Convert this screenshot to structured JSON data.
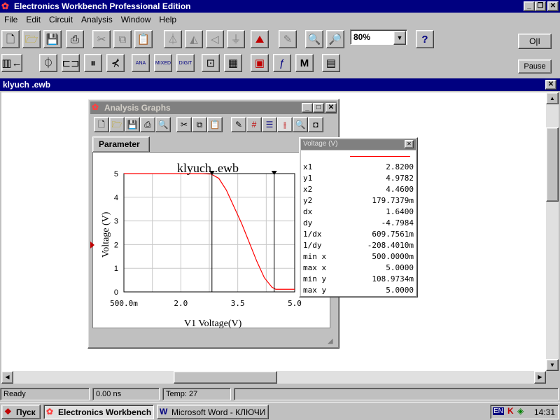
{
  "app": {
    "title": "Electronics Workbench Professional Edition",
    "menu": [
      "File",
      "Edit",
      "Circuit",
      "Analysis",
      "Window",
      "Help"
    ],
    "zoom": "80%",
    "pause_label": "Pause",
    "switch_label": "O|I"
  },
  "circuit_window": {
    "title": "klyuch .ewb"
  },
  "analysis": {
    "title": "Analysis Graphs",
    "tab": "Parameter"
  },
  "chart_data": {
    "type": "line",
    "title": "klyuch .ewb",
    "xlabel": "V1 Voltage(V)",
    "ylabel": "Voltage (V)",
    "xlim": [
      0.5,
      5.0
    ],
    "ylim": [
      0,
      5
    ],
    "x_ticks": [
      "500.0m",
      "2.0",
      "3.5",
      "5.0"
    ],
    "x_tick_values": [
      0.5,
      2.0,
      3.5,
      5.0
    ],
    "y_ticks": [
      "0",
      "1",
      "2",
      "3",
      "4",
      "5"
    ],
    "grid": true,
    "cursors": [
      2.82,
      4.46
    ],
    "series": [
      {
        "color": "#ff0000",
        "x": [
          0.5,
          2.5,
          2.8,
          3.0,
          3.2,
          3.4,
          3.6,
          3.8,
          4.0,
          4.2,
          4.4,
          4.5,
          5.0
        ],
        "y": [
          5.0,
          5.0,
          4.98,
          4.8,
          4.3,
          3.6,
          2.9,
          2.1,
          1.3,
          0.6,
          0.2,
          0.11,
          0.11
        ]
      }
    ]
  },
  "cursor_panel": {
    "title": "Voltage (V)",
    "rows": [
      {
        "label": "x1",
        "value": "2.8200"
      },
      {
        "label": "y1",
        "value": "4.9782"
      },
      {
        "label": "x2",
        "value": "4.4600"
      },
      {
        "label": "y2",
        "value": "179.7379m"
      },
      {
        "label": "dx",
        "value": "1.6400"
      },
      {
        "label": "dy",
        "value": "-4.7984"
      },
      {
        "label": "1/dx",
        "value": "609.7561m"
      },
      {
        "label": "1/dy",
        "value": "-208.4010m"
      },
      {
        "label": "min x",
        "value": "500.0000m"
      },
      {
        "label": "max x",
        "value": "5.0000"
      },
      {
        "label": "min y",
        "value": "108.9734m"
      },
      {
        "label": "max y",
        "value": "5.0000"
      }
    ]
  },
  "status": {
    "ready": "Ready",
    "time": "0.00 ns",
    "temp": "Temp:  27"
  },
  "taskbar": {
    "start": "Пуск",
    "tasks": [
      "Electronics Workbench ...",
      "Microsoft Word - КЛЮЧИ ..."
    ],
    "lang": "EN",
    "clock": "14:31"
  }
}
